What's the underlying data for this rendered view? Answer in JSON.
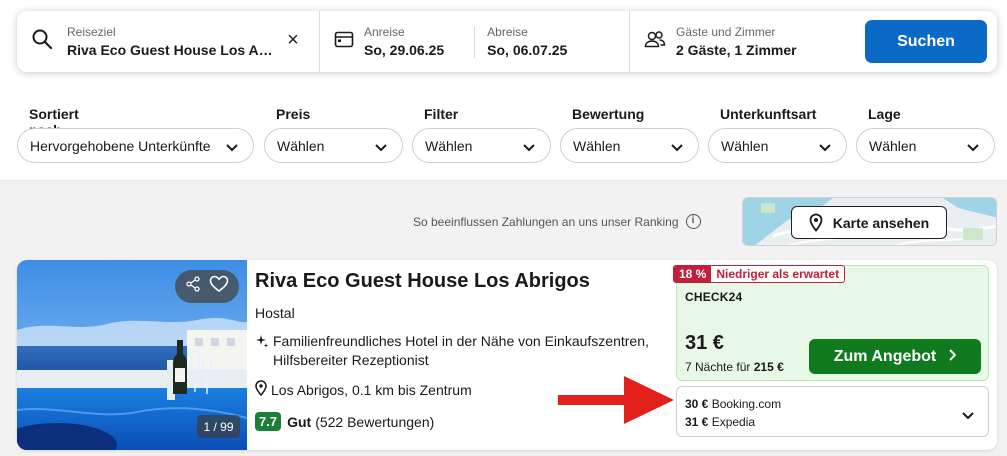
{
  "search": {
    "destination_label": "Reiseziel",
    "destination_value": "Riva Eco Guest House Los Abrigos",
    "checkin_label": "Anreise",
    "checkin_value": "So, 29.06.25",
    "checkout_label": "Abreise",
    "checkout_value": "So, 06.07.25",
    "guests_label": "Gäste und Zimmer",
    "guests_value": "2 Gäste, 1 Zimmer",
    "search_button": "Suchen"
  },
  "filters": [
    {
      "title": "Sortiert nach",
      "value": "Hervorgehobene Unterkünfte"
    },
    {
      "title": "Preis",
      "value": "Wählen"
    },
    {
      "title": "Filter",
      "value": "Wählen"
    },
    {
      "title": "Bewertung",
      "value": "Wählen"
    },
    {
      "title": "Unterkunftsart",
      "value": "Wählen"
    },
    {
      "title": "Lage",
      "value": "Wählen"
    }
  ],
  "ranking_note": "So beeinflussen Zahlungen an uns unser Ranking",
  "map": {
    "button": "Karte ansehen"
  },
  "hotel": {
    "photo_counter": "1 / 99",
    "name": "Riva Eco Guest House Los Abrigos",
    "type": "Hostal",
    "feature_line1": "Familienfreundliches Hotel in der Nähe von Einkaufszentren,",
    "feature_line2": "Hilfsbereiter Rezeptionist",
    "location": "Los Abrigos, 0.1 km bis Zentrum",
    "score": "7.7",
    "rating_label": "Gut",
    "reviews": "(522 Bewertungen)"
  },
  "deal": {
    "discount": "18 %",
    "badge": "Niedriger als erwartet",
    "provider": "CHECK24",
    "price": "31 €",
    "nights_text": "7 Nächte für",
    "total": "215 €",
    "button": "Zum Angebot"
  },
  "other_offers": [
    {
      "price": "30 €",
      "provider": "Booking.com"
    },
    {
      "price": "31 €",
      "provider": "Expedia"
    }
  ],
  "colors": {
    "primary_blue": "#0a6ac6",
    "deal_green": "#0f7a1e",
    "deal_bg": "#e8f8e6",
    "score_green": "#1a7f37",
    "badge_red": "#c0203b",
    "arrow_red": "#e3211c"
  }
}
